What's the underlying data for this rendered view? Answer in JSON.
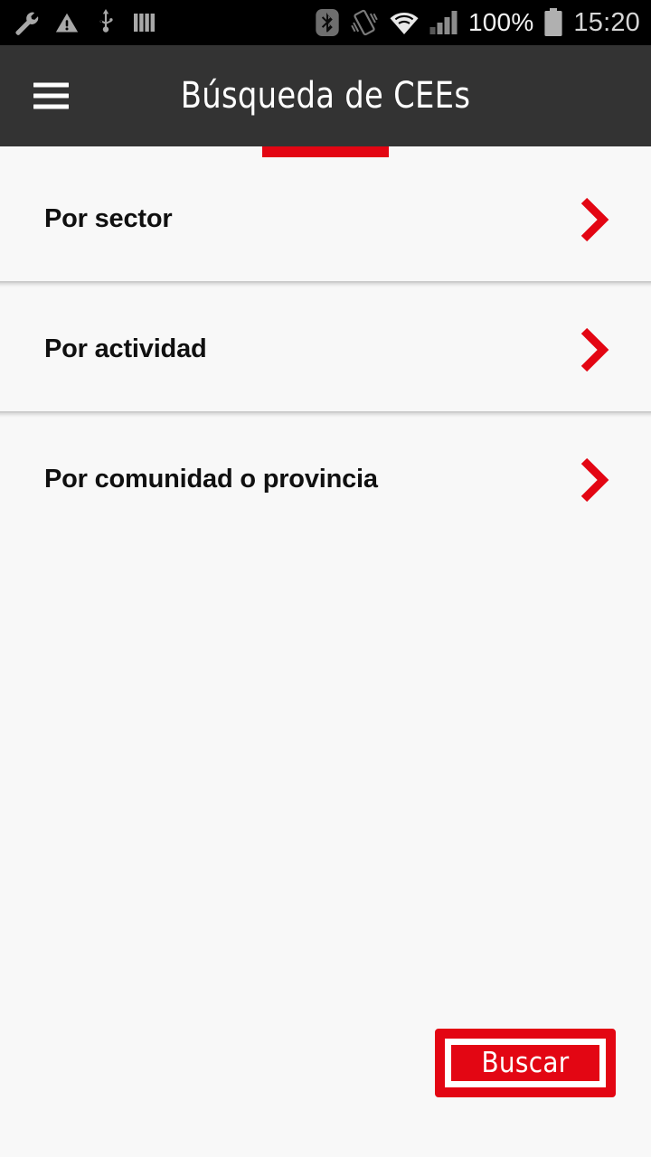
{
  "colors": {
    "accent_red": "#e30613",
    "app_bar": "#333333",
    "status_bar": "#000000",
    "page_background": "#f8f8f8",
    "text_primary": "#101010",
    "divider": "#c9c9c9"
  },
  "status_bar": {
    "left_icons": [
      {
        "name": "wrench-icon",
        "label": "wrench"
      },
      {
        "name": "warning-triangle-icon",
        "label": "warning"
      },
      {
        "name": "usb-icon",
        "label": "usb"
      },
      {
        "name": "bars-icon",
        "label": "vertical-bars"
      }
    ],
    "right_icons": [
      {
        "name": "bluetooth-icon",
        "label": "bluetooth"
      },
      {
        "name": "vibrate-icon",
        "label": "vibrate"
      },
      {
        "name": "wifi-icon",
        "label": "wifi"
      },
      {
        "name": "cellular-signal-icon",
        "label": "signal"
      }
    ],
    "battery_percent": "100%",
    "battery_icon": "battery-full-icon",
    "clock": "15:20"
  },
  "app_bar": {
    "menu_icon": "hamburger-menu-icon",
    "title": "Búsqueda de CEEs"
  },
  "tabs": {
    "indicator_color": "#e30613",
    "active_index": 0
  },
  "list": {
    "items": [
      {
        "label": "Por sector",
        "chevron": "chevron-right-icon"
      },
      {
        "label": "Por actividad",
        "chevron": "chevron-right-icon"
      },
      {
        "label": "Por comunidad o provincia",
        "chevron": "chevron-right-icon"
      }
    ]
  },
  "footer": {
    "search_button_label": "Buscar"
  }
}
